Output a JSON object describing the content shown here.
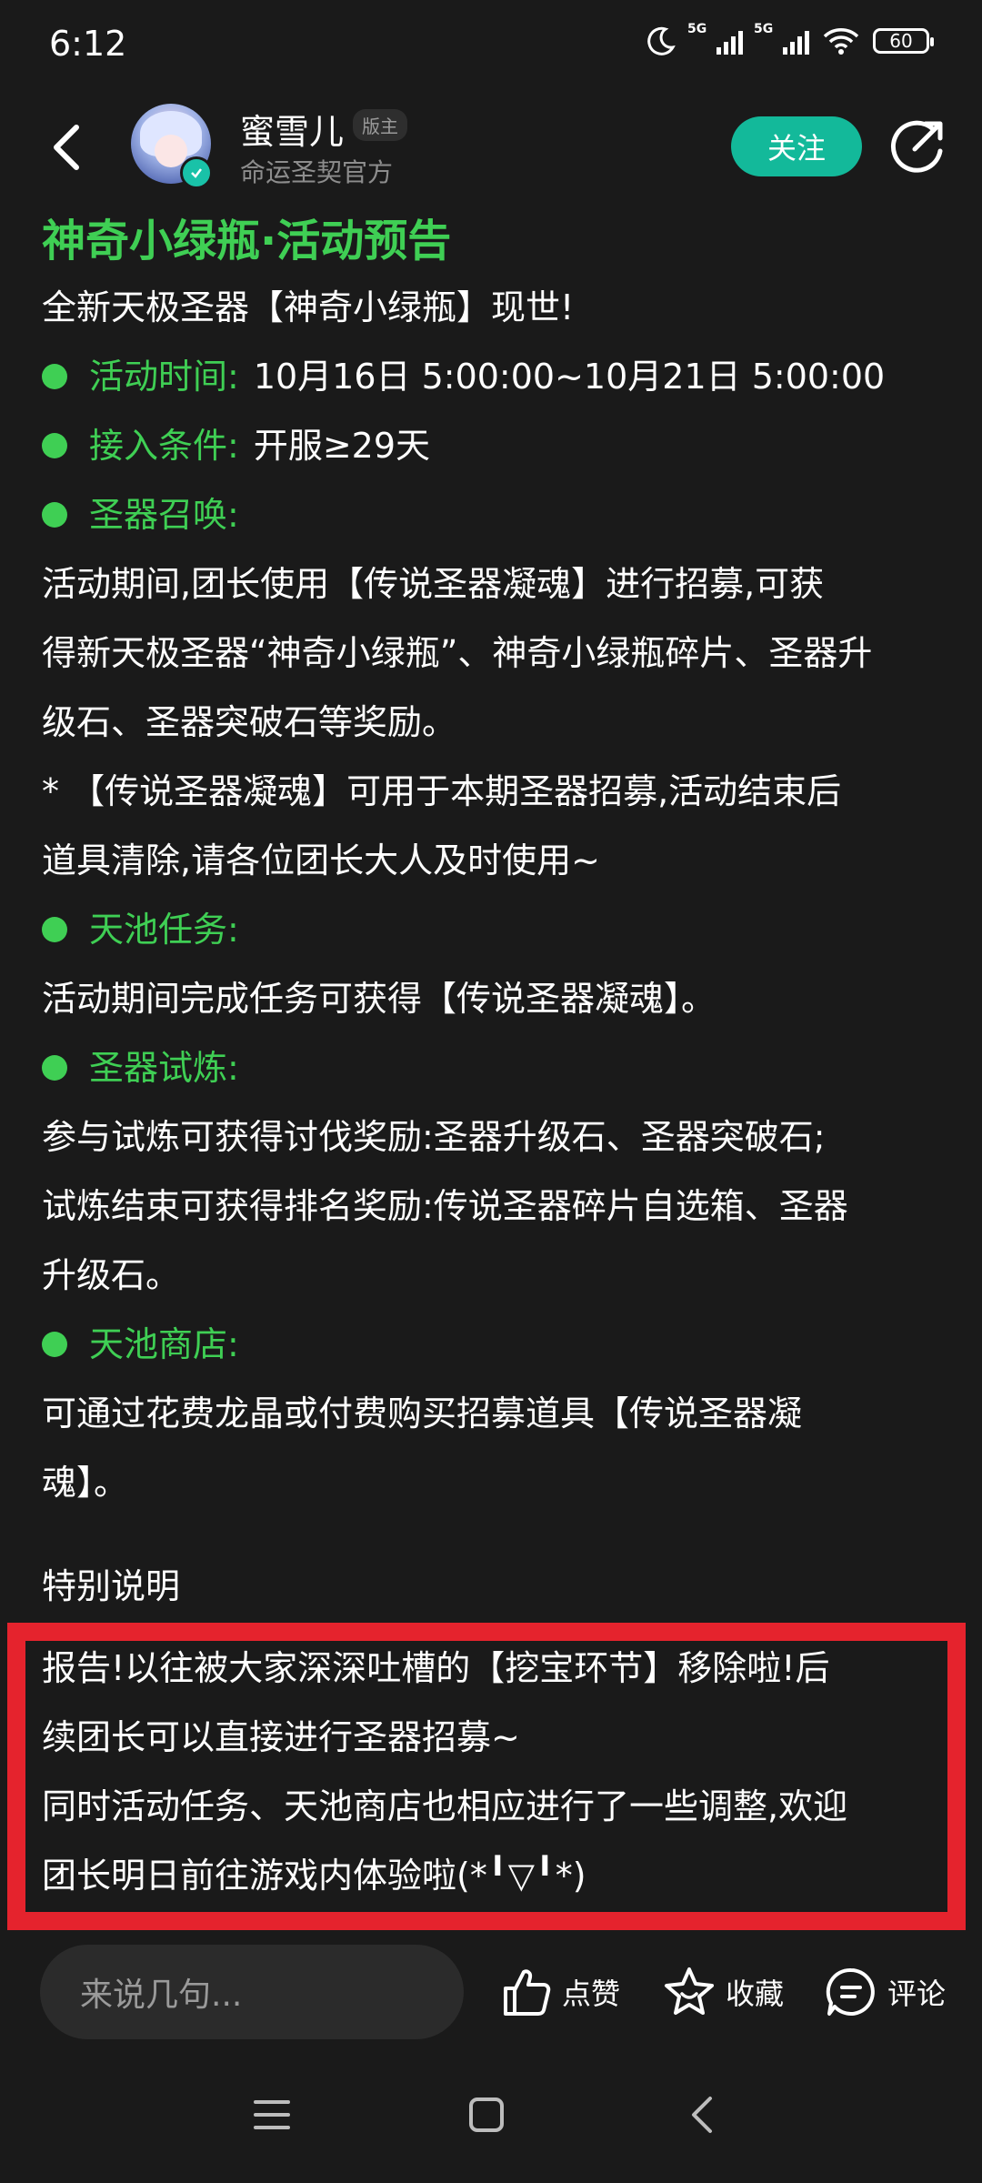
{
  "status_bar": {
    "time": "6:12",
    "sim1_label": "5G",
    "sim2_label": "5G",
    "battery": "60"
  },
  "header": {
    "author_name": "蜜雪儿",
    "badge": "版主",
    "subtitle": "命运圣契官方",
    "follow_label": "关注"
  },
  "post": {
    "title": "神奇小绿瓶·活动预告",
    "intro": "全新天极圣器【神奇小绿瓶】现世!",
    "time_label": "活动时间:",
    "time_value": "10月16日 5:00:00~10月21日 5:00:00",
    "condition_label": "接入条件:",
    "condition_value": "开服≥29天",
    "summon_label": "圣器召唤:",
    "summon_text_1": "活动期间,团长使用【传说圣器凝魂】进行招募,可获",
    "summon_text_2": "得新天极圣器“神奇小绿瓶”、神奇小绿瓶碎片、圣器升",
    "summon_text_3": "级石、圣器突破石等奖励。",
    "summon_note_1": "* 【传说圣器凝魂】可用于本期圣器招募,活动结束后",
    "summon_note_2": "道具清除,请各位团长大人及时使用~",
    "task_label": "天池任务:",
    "task_text": "活动期间完成任务可获得【传说圣器凝魂】。",
    "trial_label": "圣器试炼:",
    "trial_text_1": "参与试炼可获得讨伐奖励:圣器升级石、圣器突破石;",
    "trial_text_2": "试炼结束可获得排名奖励:传说圣器碎片自选箱、圣器",
    "trial_text_3": "升级石。",
    "shop_label": "天池商店:",
    "shop_text_1": "可通过花费龙晶或付费购买招募道具【传说圣器凝",
    "shop_text_2": "魂】。",
    "special_title": "特别说明",
    "special_1": "报告!以往被大家深深吐槽的【挖宝环节】移除啦!后",
    "special_2": "续团长可以直接进行圣器招募~",
    "special_3": "同时活动任务、天池商店也相应进行了一些调整,欢迎",
    "special_4": "团长明日前往游戏内体验啦(*╹▽╹*)"
  },
  "action_bar": {
    "comment_placeholder": "来说几句...",
    "like_label": "点赞",
    "favorite_label": "收藏",
    "comment_label": "评论"
  },
  "colors": {
    "accent_green": "#3fcf54",
    "follow_teal": "#13b99a",
    "highlight_red": "#e5232d",
    "background": "#1a1a1a"
  }
}
